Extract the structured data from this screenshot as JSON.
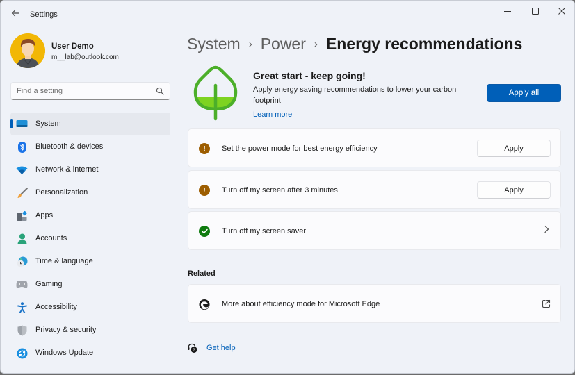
{
  "window": {
    "title": "Settings",
    "controls": [
      "minimize",
      "maximize",
      "close"
    ]
  },
  "profile": {
    "name": "User Demo",
    "email": "m__lab@outlook.com"
  },
  "search": {
    "placeholder": "Find a setting"
  },
  "sidebar": {
    "selected": "System",
    "items": [
      {
        "label": "System",
        "icon": "monitor-icon"
      },
      {
        "label": "Bluetooth & devices",
        "icon": "bluetooth-icon"
      },
      {
        "label": "Network & internet",
        "icon": "wifi-icon"
      },
      {
        "label": "Personalization",
        "icon": "brush-icon"
      },
      {
        "label": "Apps",
        "icon": "apps-icon"
      },
      {
        "label": "Accounts",
        "icon": "person-icon"
      },
      {
        "label": "Time & language",
        "icon": "globe-clock-icon"
      },
      {
        "label": "Gaming",
        "icon": "gamepad-icon"
      },
      {
        "label": "Accessibility",
        "icon": "accessibility-icon"
      },
      {
        "label": "Privacy & security",
        "icon": "shield-icon"
      },
      {
        "label": "Windows Update",
        "icon": "update-icon"
      }
    ]
  },
  "breadcrumb": {
    "items": [
      "System",
      "Power",
      "Energy recommendations"
    ],
    "separator": "›"
  },
  "hero": {
    "title": "Great start - keep going!",
    "description": "Apply energy saving recommendations to lower your carbon footprint",
    "link": "Learn more",
    "apply_all_label": "Apply all",
    "accent_color": "#005fb8",
    "leaf_color": "#4caf2a",
    "leaf_fill_color": "#7ed321"
  },
  "recommendations": [
    {
      "label": "Set the power mode for best energy efficiency",
      "status": "warning",
      "action": "Apply"
    },
    {
      "label": "Turn off my screen after 3 minutes",
      "status": "warning",
      "action": "Apply"
    },
    {
      "label": "Turn off my screen saver",
      "status": "done",
      "action": "chevron"
    }
  ],
  "status_colors": {
    "warning": "#9d5d00",
    "done": "#0f7b0f"
  },
  "related": {
    "title": "Related",
    "items": [
      {
        "label": "More about efficiency mode for Microsoft Edge",
        "icon": "edge-icon",
        "trailing": "external-link-icon"
      }
    ]
  },
  "help": {
    "label": "Get help"
  }
}
